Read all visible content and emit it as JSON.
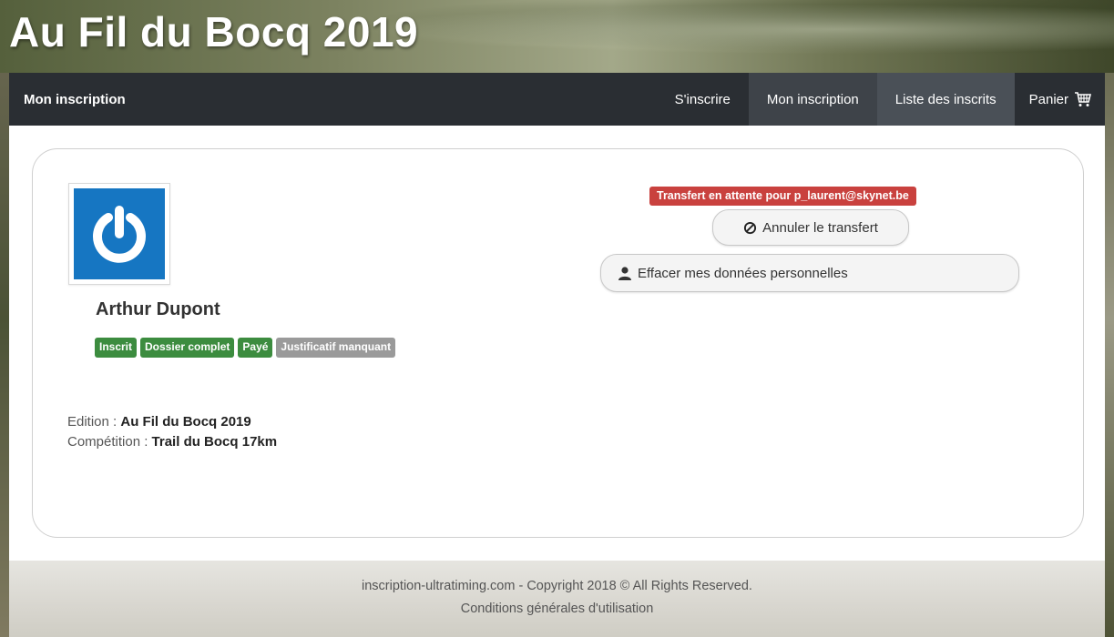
{
  "site": {
    "title": "Au Fil du Bocq 2019"
  },
  "navbar": {
    "brand": "Mon inscription",
    "items": [
      {
        "label": "S'inscrire"
      },
      {
        "label": "Mon inscription"
      },
      {
        "label": "Liste des inscrits"
      },
      {
        "label": "Panier"
      }
    ]
  },
  "profile": {
    "name": "Arthur Dupont",
    "badges": [
      {
        "label": "Inscrit",
        "color": "#3c8c3f"
      },
      {
        "label": "Dossier complet",
        "color": "#3c8c3f"
      },
      {
        "label": "Payé",
        "color": "#3c8c3f"
      },
      {
        "label": "Justificatif manquant",
        "color": "#9a9a9a"
      }
    ],
    "edition_label": "Edition :",
    "edition_value": "Au Fil du Bocq 2019",
    "competition_label": "Compétition :",
    "competition_value": "Trail du Bocq 17km"
  },
  "actions": {
    "transfer_alert": "Transfert en attente pour p_laurent@skynet.be",
    "cancel_transfer": "Annuler le transfert",
    "erase_data": "Effacer mes données personnelles"
  },
  "footer": {
    "copyright": "inscription-ultratiming.com - Copyright 2018 © All Rights Reserved.",
    "terms": "Conditions générales d'utilisation"
  },
  "colors": {
    "navbar": "#2a2e33",
    "alert": "#c9413e",
    "avatar": "#1676c2"
  }
}
